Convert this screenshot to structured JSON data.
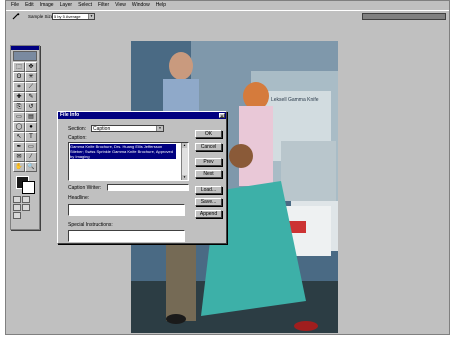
{
  "menu": [
    "File",
    "Edit",
    "Image",
    "Layer",
    "Select",
    "Filter",
    "View",
    "Window",
    "Help"
  ],
  "options_bar": {
    "tool_icon": "eyedropper-icon",
    "sample_size_label": "Sample Size:",
    "sample_size_value": "5 by 5 Average"
  },
  "toolbox": {
    "tools": [
      "marquee",
      "move",
      "lasso",
      "magic-wand",
      "crop",
      "slice",
      "healing",
      "brush",
      "stamp",
      "history-brush",
      "eraser",
      "gradient",
      "blur",
      "dodge",
      "path-select",
      "type",
      "pen",
      "shape",
      "notes",
      "eyedropper",
      "hand",
      "zoom"
    ],
    "tool_glyphs": [
      "⬚",
      "✥",
      "ʘ",
      "✳",
      "⌗",
      "⟋",
      "✚",
      "✎",
      "⎘",
      "↺",
      "▭",
      "▤",
      "◯",
      "●",
      "↖",
      "T",
      "✒",
      "▭",
      "✉",
      "⁄",
      "✋",
      "🔍"
    ]
  },
  "dialog": {
    "title": "File Info",
    "close_glyph": "×",
    "section_label": "Section:",
    "section_value": "Caption",
    "caption_label": "Caption:",
    "caption_text": "Gamma Knife Brochure, Drs. Huang Ellis Jeffersson Stieber; Swiss Sprinkle Gamma Knife Brochure, Approved by Imaging",
    "caption_writer_label": "Caption Writer:",
    "caption_writer_value": "",
    "headline_label": "Headline:",
    "headline_value": "",
    "special_instructions_label": "Special Instructions:",
    "special_instructions_value": "",
    "buttons": [
      "OK",
      "Cancel",
      "Prev",
      "Next",
      "Load...",
      "Save...",
      "Append"
    ]
  },
  "photo": {
    "wall_sign": "Leksell Gamma Knife"
  }
}
